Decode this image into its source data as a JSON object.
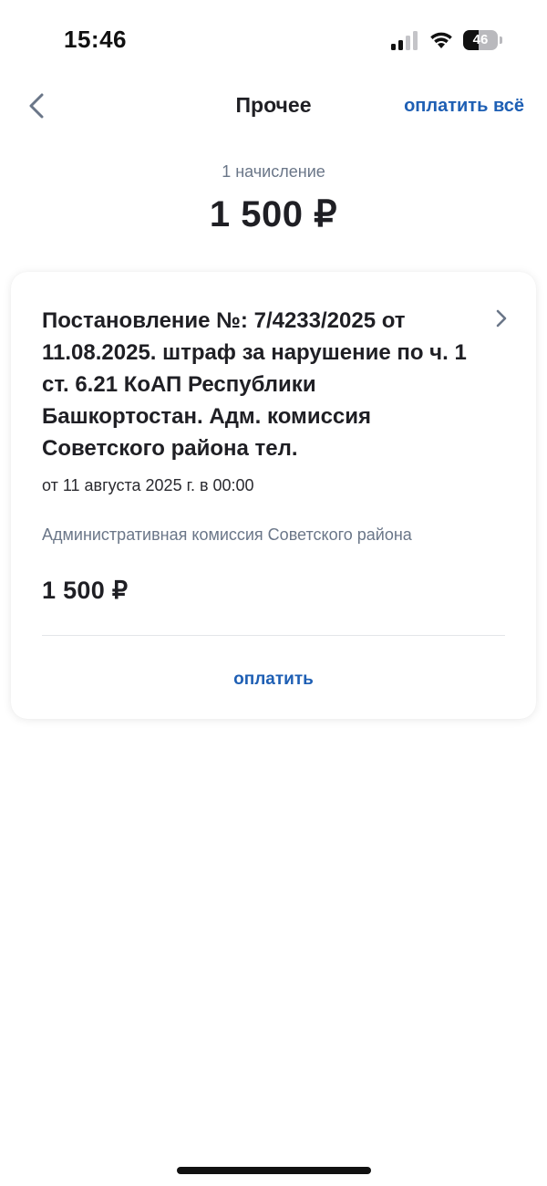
{
  "status_bar": {
    "time": "15:46",
    "signal_icon": "cellular-signal-icon",
    "wifi_icon": "wifi-icon",
    "battery_icon": "battery-icon",
    "battery_level": "46",
    "battery_fraction": 0.46
  },
  "nav": {
    "back_icon": "chevron-left-icon",
    "title": "Прочее",
    "pay_all_label": "оплатить всё"
  },
  "summary": {
    "count_label": "1 начисление",
    "total": "1 500 ₽"
  },
  "charges": [
    {
      "title": "Постановление №: 7/4233/2025 от 11.08.2025. штраф за нарушение по ч. 1 ст. 6.21 КоАП Республики Башкортостан. Адм. комиссия Советского района тел.",
      "date": "от 11 августа 2025 г. в 00:00",
      "organization": "Административная комиссия Советского района",
      "amount": "1 500 ₽",
      "pay_label": "оплатить",
      "chevron_icon": "chevron-right-icon"
    }
  ],
  "colors": {
    "accent": "#1e5fb4",
    "primary_text": "#1f1f24",
    "secondary_text": "#6a7688",
    "divider": "#e3e5e9",
    "background": "#ffffff"
  }
}
